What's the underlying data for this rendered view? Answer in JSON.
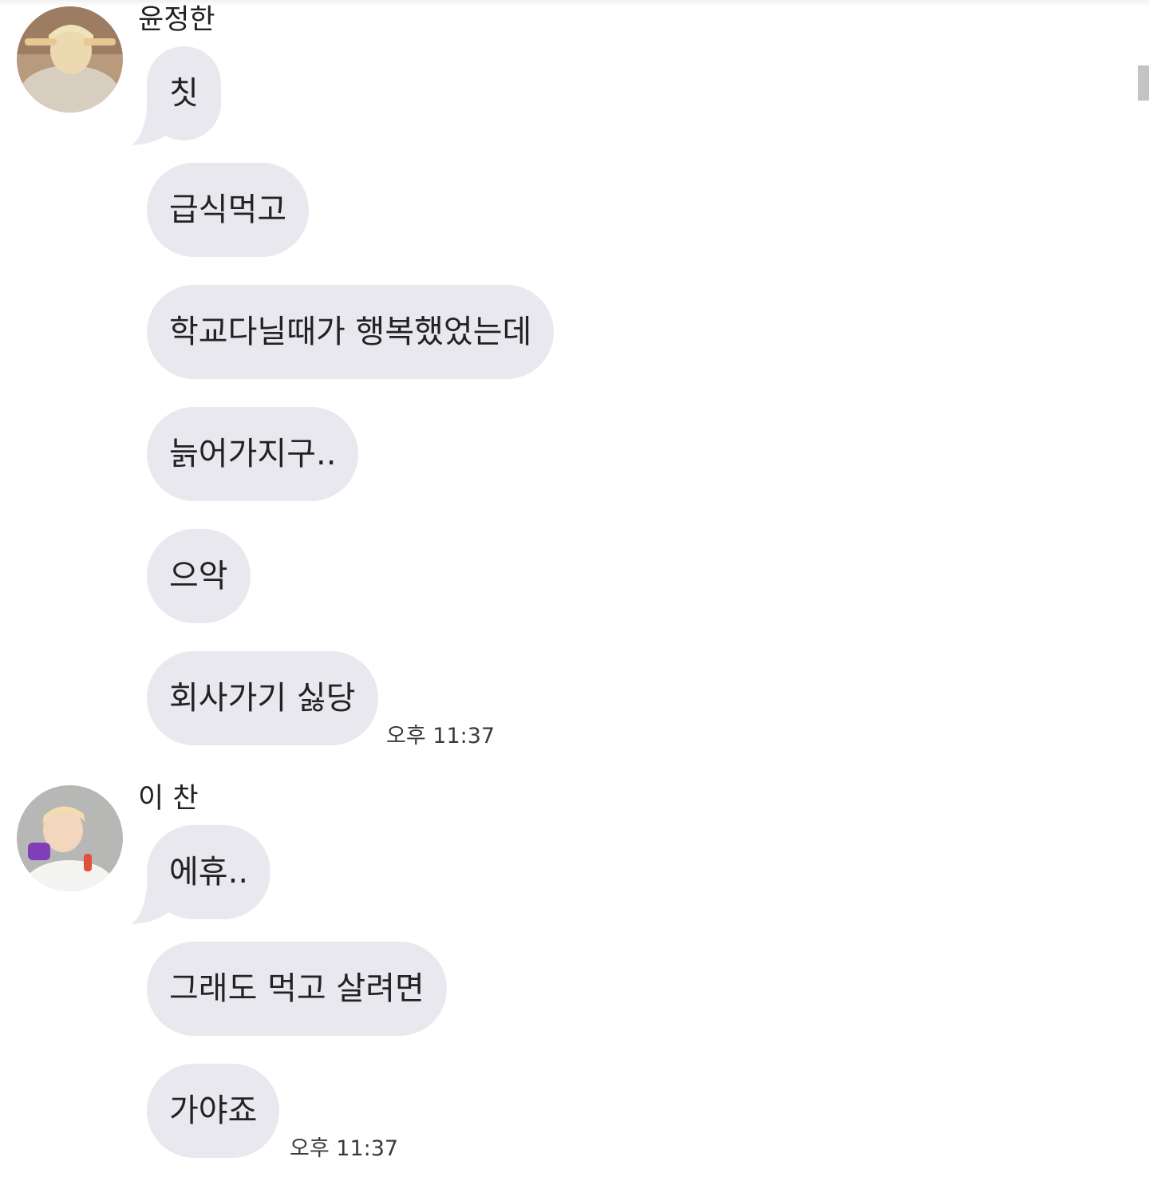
{
  "groups": [
    {
      "sender": "윤정한",
      "avatar_icon": "profile-photo-icon",
      "messages": [
        "칫",
        "급식먹고",
        "학교다닐때가 행복했었는데",
        "늙어가지구..",
        "으악",
        "회사가기 싫당"
      ],
      "time": "오후 11:37"
    },
    {
      "sender": "이 찬",
      "avatar_icon": "profile-photo-icon",
      "messages": [
        "에휴..",
        "그래도 먹고 살려면",
        "가야죠"
      ],
      "time": "오후 11:37"
    }
  ],
  "colors": {
    "bubble": "#e9e8ee",
    "text": "#222222",
    "background": "#ffffff"
  }
}
